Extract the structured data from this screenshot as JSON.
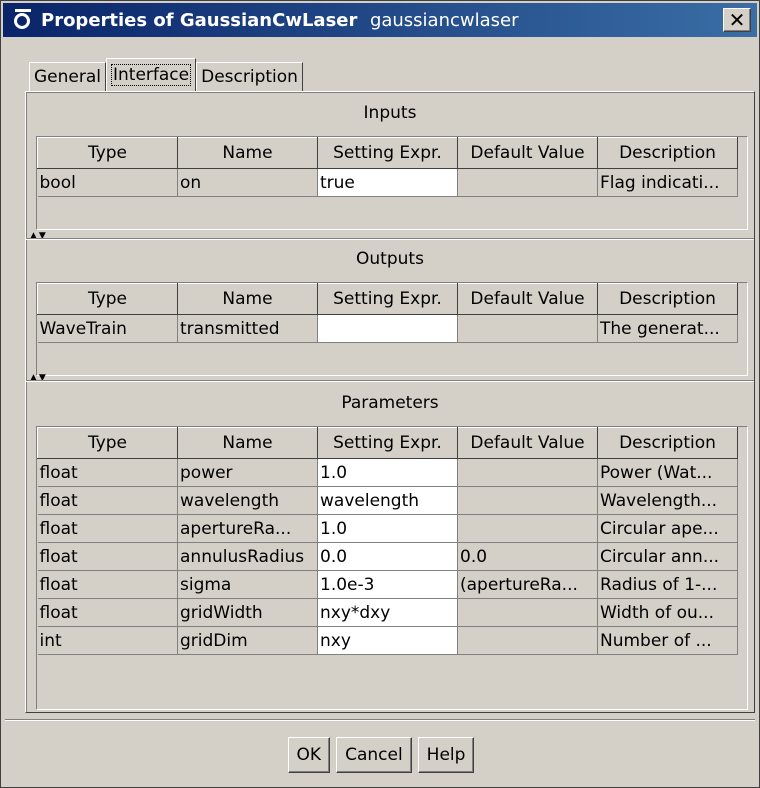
{
  "window": {
    "title_bold": "Properties of GaussianCwLaser",
    "title_light": "gaussiancwlaser",
    "close_glyph": "✕"
  },
  "tabs": [
    {
      "label": "General"
    },
    {
      "label": "Interface",
      "active": true
    },
    {
      "label": "Description"
    }
  ],
  "columns": [
    "Type",
    "Name",
    "Setting Expr.",
    "Default Value",
    "Description"
  ],
  "inputs": {
    "title": "Inputs",
    "rows": [
      {
        "type": "bool",
        "name": "on",
        "setting": "true",
        "default": "",
        "description": "Flag indicati..."
      }
    ]
  },
  "outputs": {
    "title": "Outputs",
    "rows": [
      {
        "type": "WaveTrain",
        "name": "transmitted",
        "setting": "",
        "default": "",
        "description": "The generat..."
      }
    ]
  },
  "parameters": {
    "title": "Parameters",
    "rows": [
      {
        "type": "float",
        "name": "power",
        "setting": "1.0",
        "default": "",
        "description": "Power (Wat..."
      },
      {
        "type": "float",
        "name": "wavelength",
        "setting": "wavelength",
        "default": "",
        "description": "Wavelength..."
      },
      {
        "type": "float",
        "name": "apertureRa...",
        "setting": "1.0",
        "default": "",
        "description": "Circular ape..."
      },
      {
        "type": "float",
        "name": "annulusRadius",
        "setting": "0.0",
        "default": "0.0",
        "description": "Circular ann..."
      },
      {
        "type": "float",
        "name": "sigma",
        "setting": "1.0e-3",
        "default": "(apertureRa...",
        "description": "Radius of 1-..."
      },
      {
        "type": "float",
        "name": "gridWidth",
        "setting": "nxy*dxy",
        "default": "",
        "description": "Width of ou..."
      },
      {
        "type": "int",
        "name": "gridDim",
        "setting": "nxy",
        "default": "",
        "description": "Number of ..."
      }
    ]
  },
  "buttons": {
    "ok": "OK",
    "cancel": "Cancel",
    "help": "Help"
  },
  "divider_arrows": "▲▼"
}
